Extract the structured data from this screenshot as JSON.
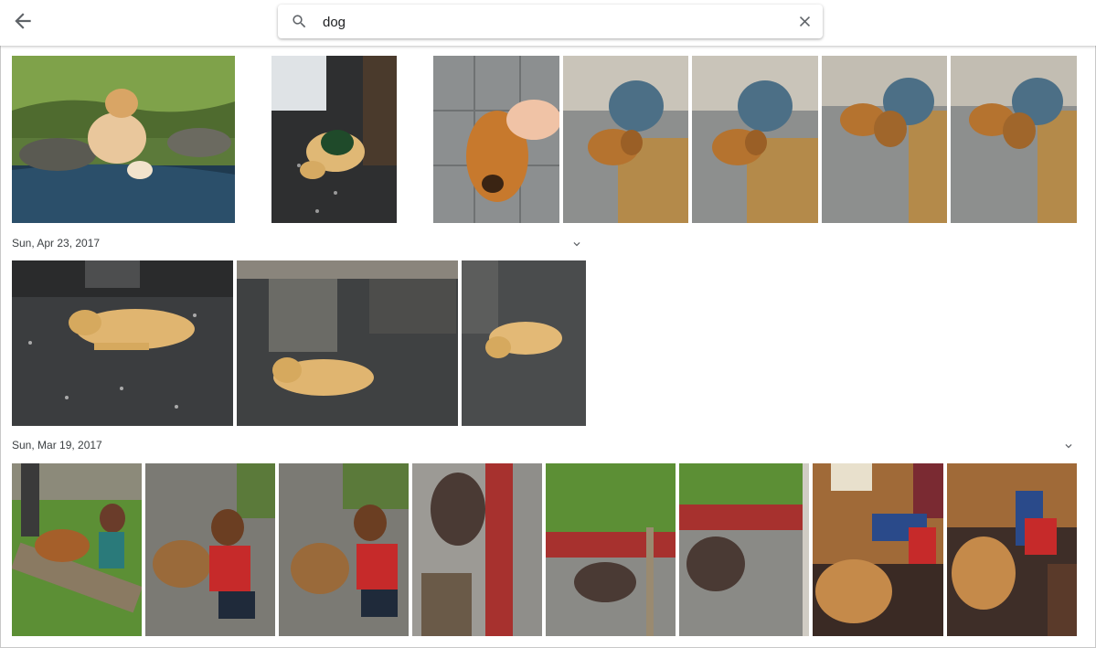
{
  "search": {
    "query": "dog"
  },
  "icons": {
    "back": "arrow-back-icon",
    "search": "search-icon",
    "clear": "close-icon",
    "expand": "chevron-down-icon"
  },
  "sections": [
    {
      "date": ""
    },
    {
      "date": "Sun, Apr 23, 2017"
    },
    {
      "date": "Sun, Mar 19, 2017"
    }
  ],
  "colors": {
    "accent_red": "#a7312e",
    "grass": "#5c8f35",
    "floor_dark": "#3b3d3f"
  }
}
